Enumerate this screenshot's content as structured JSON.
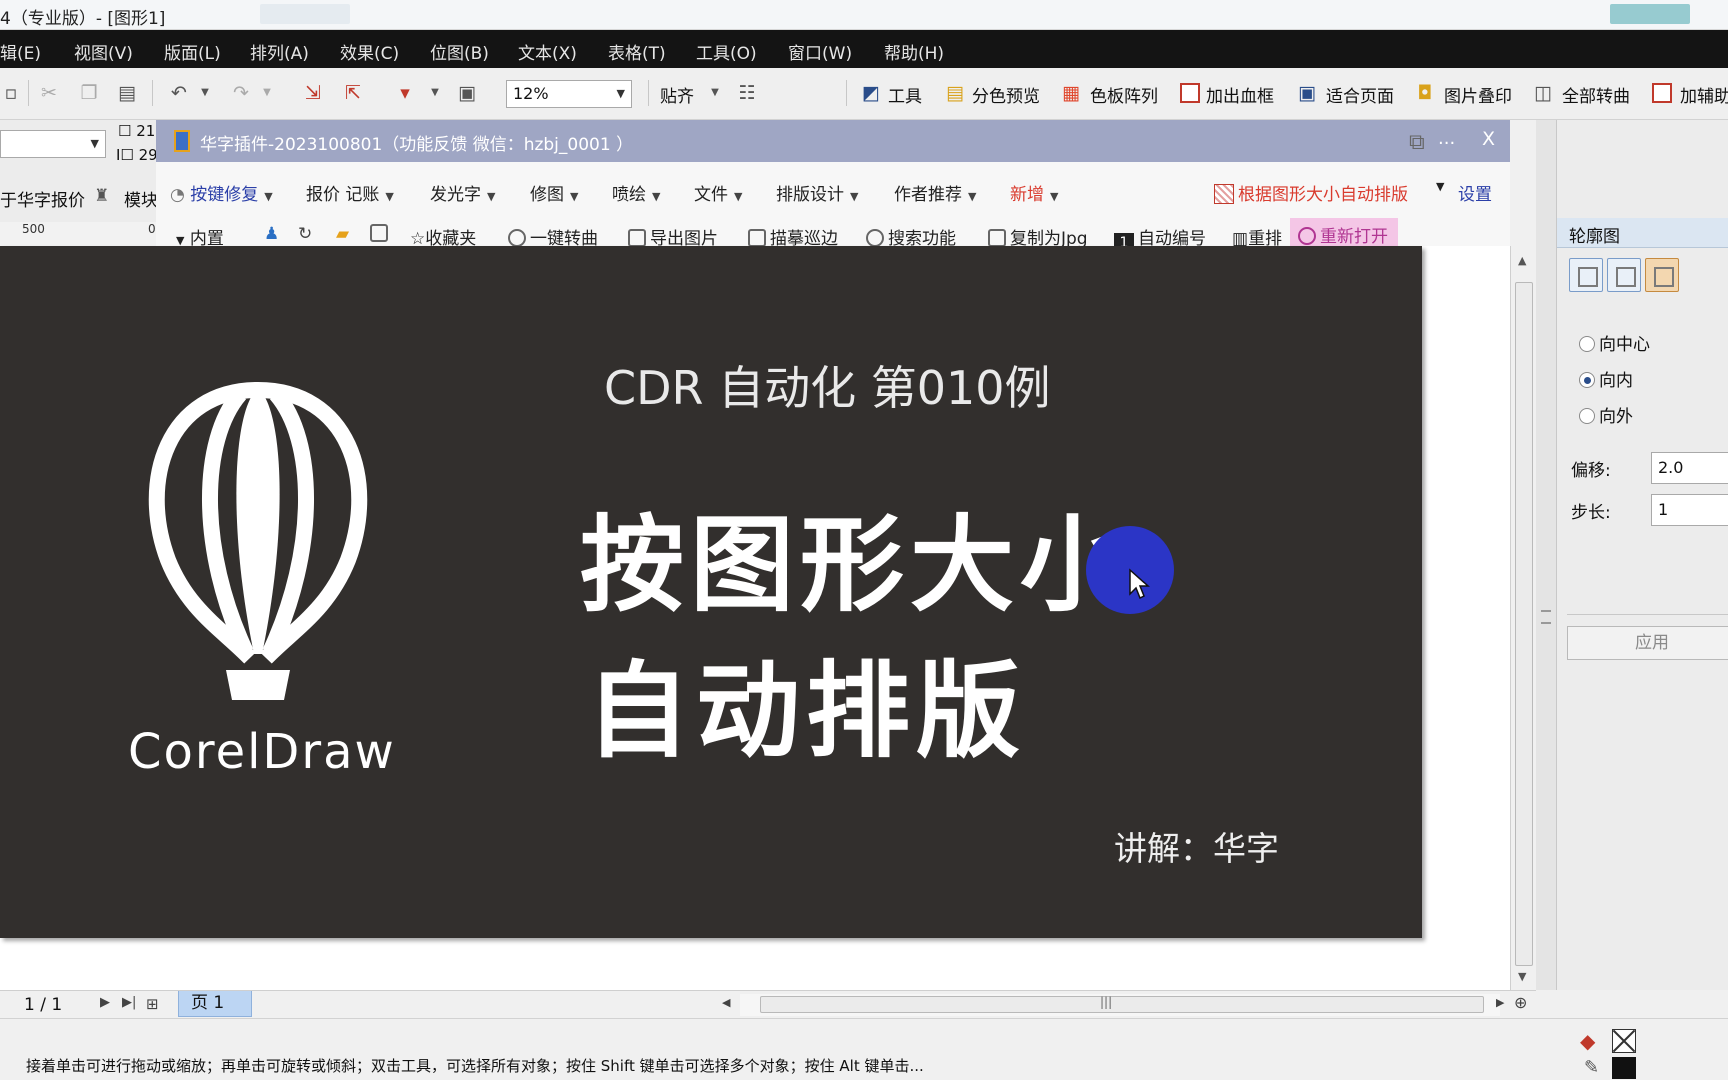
{
  "titlebar": {
    "title": "4（专业版）- [图形1]"
  },
  "menubar": {
    "items": [
      "辑(E)",
      "视图(V)",
      "版面(L)",
      "排列(A)",
      "效果(C)",
      "位图(B)",
      "文本(X)",
      "表格(T)",
      "工具(O)",
      "窗口(W)",
      "帮助(H)"
    ]
  },
  "toolbar": {
    "zoom": "12%",
    "snap_label": "贴齐",
    "buttons": [
      "工具",
      "分色预览",
      "色板阵列",
      "加出血框",
      "适合页面",
      "图片叠印",
      "全部转曲",
      "加辅助"
    ]
  },
  "propbar": {
    "width_value": "21",
    "height_value": "29"
  },
  "leftstrip": {
    "quote_label": "华字报价",
    "module_label": "模块"
  },
  "ruler": {
    "tick_500": "500",
    "tick_0": "0"
  },
  "plugin": {
    "title": "华字插件-2023100801（功能反馈 微信：hzbj_0001 ）",
    "minimize": "...",
    "close": "X",
    "menus": [
      {
        "label": "按键修复",
        "color": "#2b3fa8"
      },
      {
        "label": "报价 记账",
        "color": "#222222"
      },
      {
        "label": "发光字",
        "color": "#222222"
      },
      {
        "label": "修图",
        "color": "#222222"
      },
      {
        "label": "喷绘",
        "color": "#222222"
      },
      {
        "label": "文件",
        "color": "#222222"
      },
      {
        "label": "排版设计",
        "color": "#222222"
      },
      {
        "label": "作者推荐",
        "color": "#222222"
      },
      {
        "label": "新增",
        "color": "#d93b2e"
      }
    ],
    "auto_layout_label": "根据图形大小自动排版",
    "settings_label": "设置",
    "tools": [
      "内置",
      "收藏夹",
      "一键转曲",
      "导出图片",
      "描摹巡边",
      "搜索功能",
      "复制为Jpg",
      "自动编号",
      "重排",
      "重新打开"
    ]
  },
  "canvas": {
    "logo_text": "CorelDraw",
    "subtitle": "CDR 自动化 第010例",
    "headline_line1": "按图形大小",
    "headline_line2": "自动排版",
    "author": "讲解：华字"
  },
  "docker": {
    "title": "轮廓图",
    "radio_options": [
      "向中心",
      "向内",
      "向外"
    ],
    "selected_radio": "向内",
    "offset_label": "偏移:",
    "offset_value": "2.0",
    "steps_label": "步长:",
    "steps_value": "1",
    "apply_label": "应用"
  },
  "pagebar": {
    "page_count": "1 / 1",
    "page_tab": "页 1"
  },
  "statusbar": {
    "message": "接着单击可进行拖动或缩放；再单击可旋转或倾斜；双击工具，可选择所有对象；按住 Shift 键单击可选择多个对象；按住 Alt 键单击..."
  },
  "colors": {
    "page_bg": "#322f2d",
    "plugin_title_bg": "#9fa6c4",
    "accent_red": "#d93b2e",
    "accent_blue": "#2b3fa8",
    "cursor_highlight": "#2b35c6"
  }
}
